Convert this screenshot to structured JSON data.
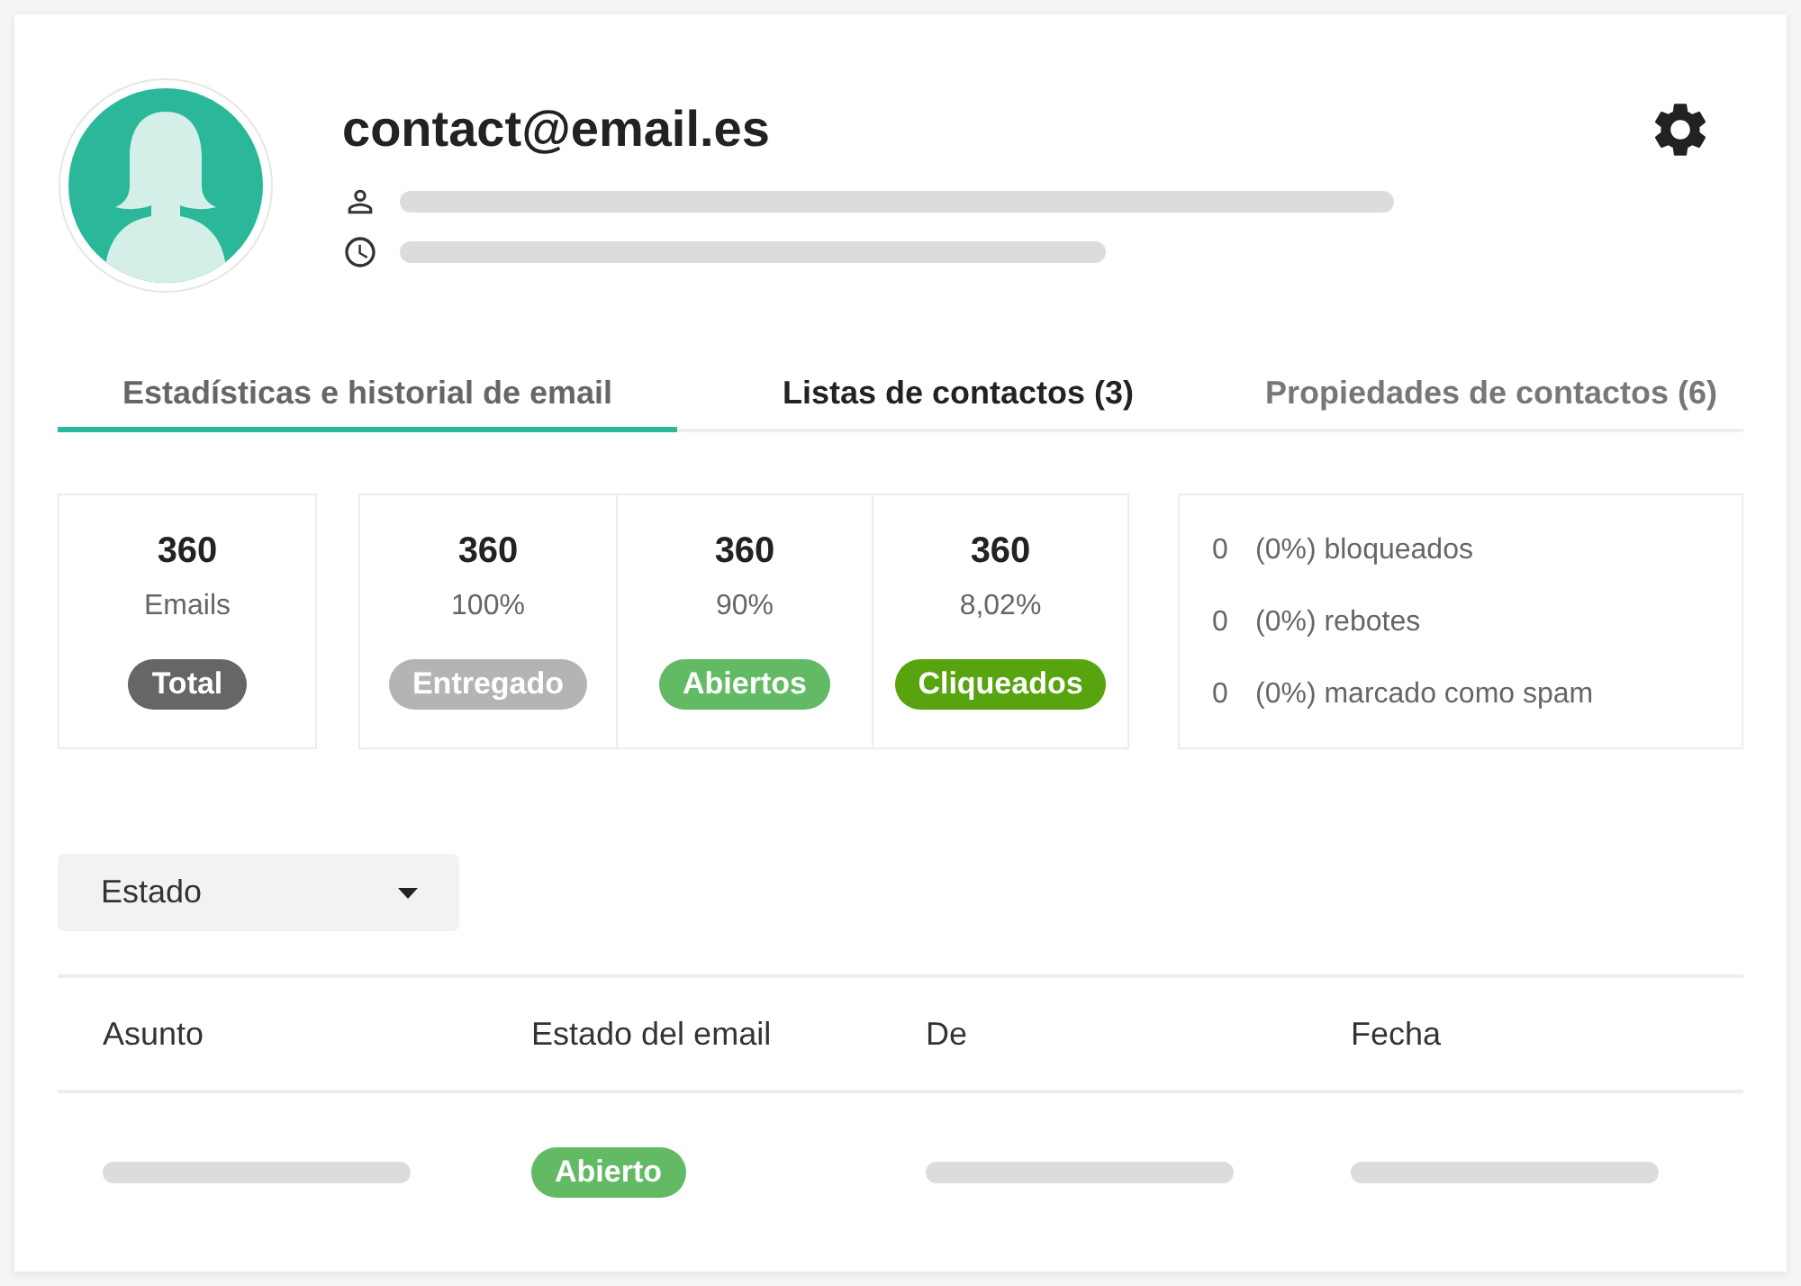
{
  "contact": {
    "email": "contact@email.es"
  },
  "tabs": [
    {
      "label": "Estadísticas e historial de email",
      "selected": true,
      "hovered": false
    },
    {
      "label": "Listas de contactos (3)",
      "selected": false,
      "hovered": true
    },
    {
      "label": "Propiedades de contactos (6)",
      "selected": false,
      "hovered": false
    }
  ],
  "stat_cards": [
    {
      "cells": [
        {
          "value": "360",
          "caption": "Emails",
          "badge": "Total",
          "color": "#666666"
        }
      ]
    },
    {
      "cells": [
        {
          "value": "360",
          "caption": "100%",
          "badge": "Entregado",
          "color": "#b4b4b4"
        },
        {
          "value": "360",
          "caption": "90%",
          "badge": "Abiertos",
          "color": "#62bb64"
        },
        {
          "value": "360",
          "caption": "8,02%",
          "badge": "Cliqueados",
          "color": "#57a40f"
        }
      ]
    }
  ],
  "issues": [
    {
      "count": "0",
      "label": "(0%) bloqueados"
    },
    {
      "count": "0",
      "label": "(0%) rebotes"
    },
    {
      "count": "0",
      "label": "(0%) marcado como spam"
    }
  ],
  "filter": {
    "value": "Estado"
  },
  "table": {
    "columns": [
      "Asunto",
      "Estado del email",
      "De",
      "Fecha"
    ],
    "rows": [
      {
        "cells": [
          {
            "kind": "placeholder"
          },
          {
            "kind": "badge",
            "label": "Abierto",
            "color": "#62bb64"
          },
          {
            "kind": "placeholder"
          },
          {
            "kind": "placeholder"
          }
        ]
      }
    ]
  }
}
